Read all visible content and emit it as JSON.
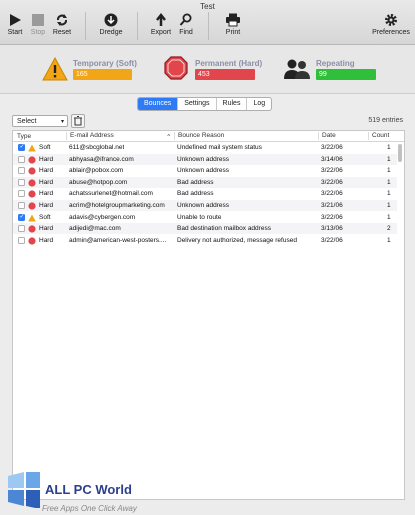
{
  "window": {
    "title": "Test"
  },
  "toolbar": {
    "start": "Start",
    "stop": "Stop",
    "reset": "Reset",
    "dredge": "Dredge",
    "export": "Export",
    "find": "Find",
    "print": "Print",
    "preferences": "Preferences"
  },
  "status": {
    "temporary": {
      "label": "Temporary (Soft)",
      "value": "165",
      "color": "#f2a516"
    },
    "permanent": {
      "label": "Permanent (Hard)",
      "value": "453",
      "color": "#e0464c"
    },
    "repeating": {
      "label": "Repeating",
      "value": "99",
      "color": "#2fbf3a"
    }
  },
  "tabs": [
    "Bounces",
    "Settings",
    "Rules",
    "Log"
  ],
  "active_tab": "Bounces",
  "filter": {
    "select_value": "Select",
    "entries": "519 entries"
  },
  "table": {
    "headers": {
      "type": "Type",
      "email": "E-mail Address",
      "reason": "Bounce Reason",
      "date": "Date",
      "count": "Count"
    },
    "rows": [
      {
        "checked": true,
        "type": "Soft",
        "email": "611@sbcglobal.net",
        "reason": "Undefined mail system status",
        "date": "3/22/06",
        "count": "1"
      },
      {
        "checked": false,
        "type": "Hard",
        "email": "abhyasa@ifrance.com",
        "reason": "Unknown address",
        "date": "3/14/06",
        "count": "1"
      },
      {
        "checked": false,
        "type": "Hard",
        "email": "ablair@pobox.com",
        "reason": "Unknown address",
        "date": "3/22/06",
        "count": "1"
      },
      {
        "checked": false,
        "type": "Hard",
        "email": "abuse@hotpop.com",
        "reason": "Bad address",
        "date": "3/22/06",
        "count": "1"
      },
      {
        "checked": false,
        "type": "Hard",
        "email": "achatssurlenet@hotmail.com",
        "reason": "Bad address",
        "date": "3/22/06",
        "count": "1"
      },
      {
        "checked": false,
        "type": "Hard",
        "email": "acrim@hotelgroupmarketing.com",
        "reason": "Unknown address",
        "date": "3/21/06",
        "count": "1"
      },
      {
        "checked": true,
        "type": "Soft",
        "email": "adavis@cybergen.com",
        "reason": "Unable to route",
        "date": "3/22/06",
        "count": "1"
      },
      {
        "checked": false,
        "type": "Hard",
        "email": "adijedi@mac.com",
        "reason": "Bad destination mailbox address",
        "date": "3/13/06",
        "count": "2"
      },
      {
        "checked": false,
        "type": "Hard",
        "email": "admin@american-west-posters....",
        "reason": "Delivery not authorized, message refused",
        "date": "3/22/06",
        "count": "1"
      }
    ]
  },
  "watermark": {
    "title": "ALL PC World",
    "subtitle": "Free Apps One Click Away"
  }
}
